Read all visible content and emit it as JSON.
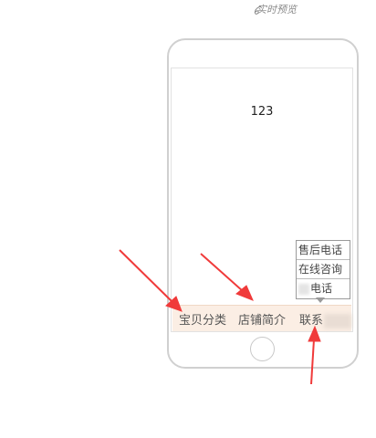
{
  "preview": {
    "label": "实时预览"
  },
  "screen": {
    "content_text": "123"
  },
  "contact_menu": {
    "items": [
      "售后电话",
      "在线咨询",
      "电话"
    ]
  },
  "tabbar": {
    "tabs": [
      "宝贝分类",
      "店铺简介",
      "联系"
    ]
  },
  "colors": {
    "arrow": "#f03a3a",
    "tabbar_bg": "#fbeee4",
    "phone_border": "#d0d0d0"
  }
}
